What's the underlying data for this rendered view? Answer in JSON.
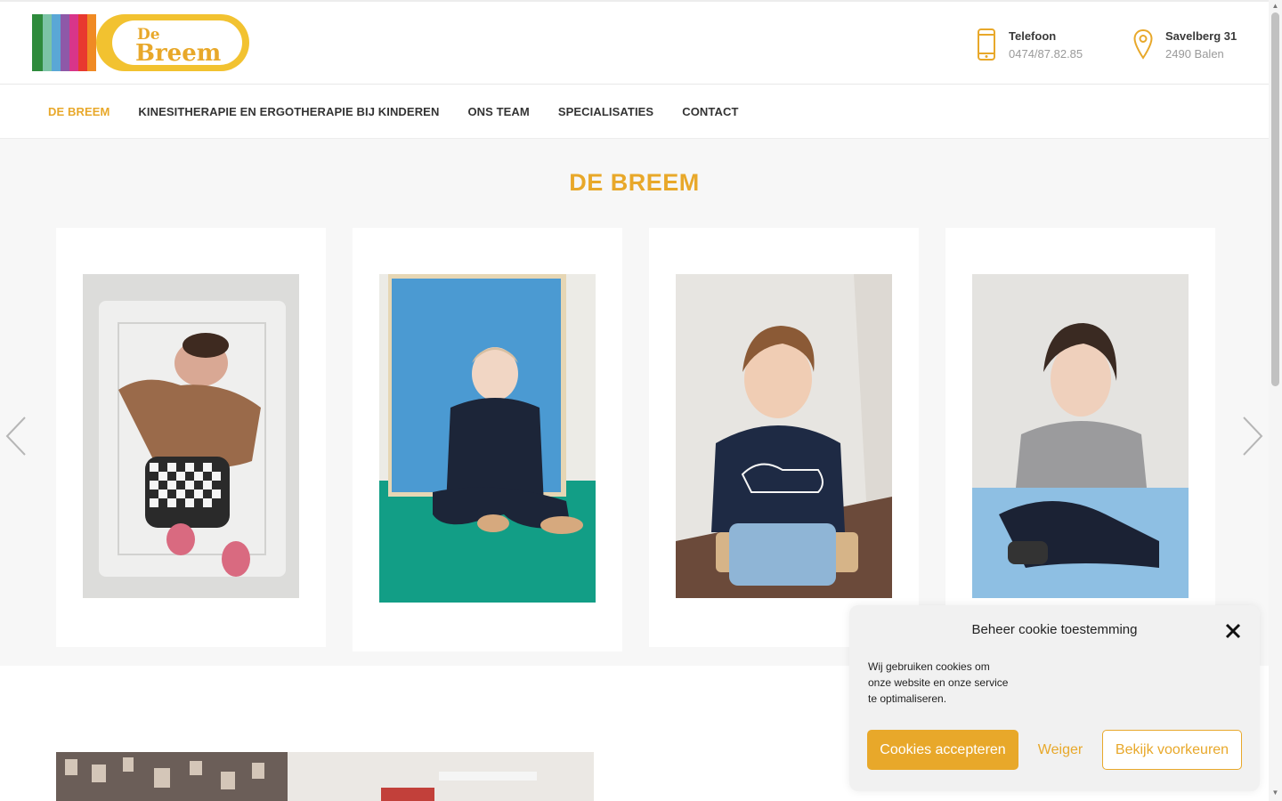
{
  "header": {
    "logo_text_top": "De",
    "logo_text_main": "Breem",
    "phone": {
      "title": "Telefoon",
      "value": "0474/87.82.85",
      "icon": "phone-icon"
    },
    "address": {
      "title": "Savelberg 31",
      "value": "2490 Balen",
      "icon": "location-pin-icon"
    }
  },
  "nav": {
    "items": [
      {
        "label": "DE BREEM",
        "active": true
      },
      {
        "label": "KINESITHERAPIE EN ERGOTHERAPIE BIJ KINDEREN"
      },
      {
        "label": "ONS TEAM"
      },
      {
        "label": "SPECIALISATIES"
      },
      {
        "label": "CONTACT"
      }
    ]
  },
  "hero": {
    "title": "DE BREEM",
    "slides": [
      {
        "alt": "baby lying on blanket"
      },
      {
        "alt": "toddler sitting against blue mat"
      },
      {
        "alt": "boy sitting on wooden stool"
      },
      {
        "alt": "girl sitting on blue block"
      }
    ]
  },
  "cookie": {
    "title": "Beheer cookie toestemming",
    "text": "Wij gebruiken cookies om onze website en onze service te optimaliseren.",
    "accept": "Cookies accepteren",
    "deny": "Weiger",
    "prefs": "Bekijk voorkeuren"
  },
  "colors": {
    "accent": "#e8a82a",
    "band": "#f7f7f7",
    "text": "#333333"
  }
}
